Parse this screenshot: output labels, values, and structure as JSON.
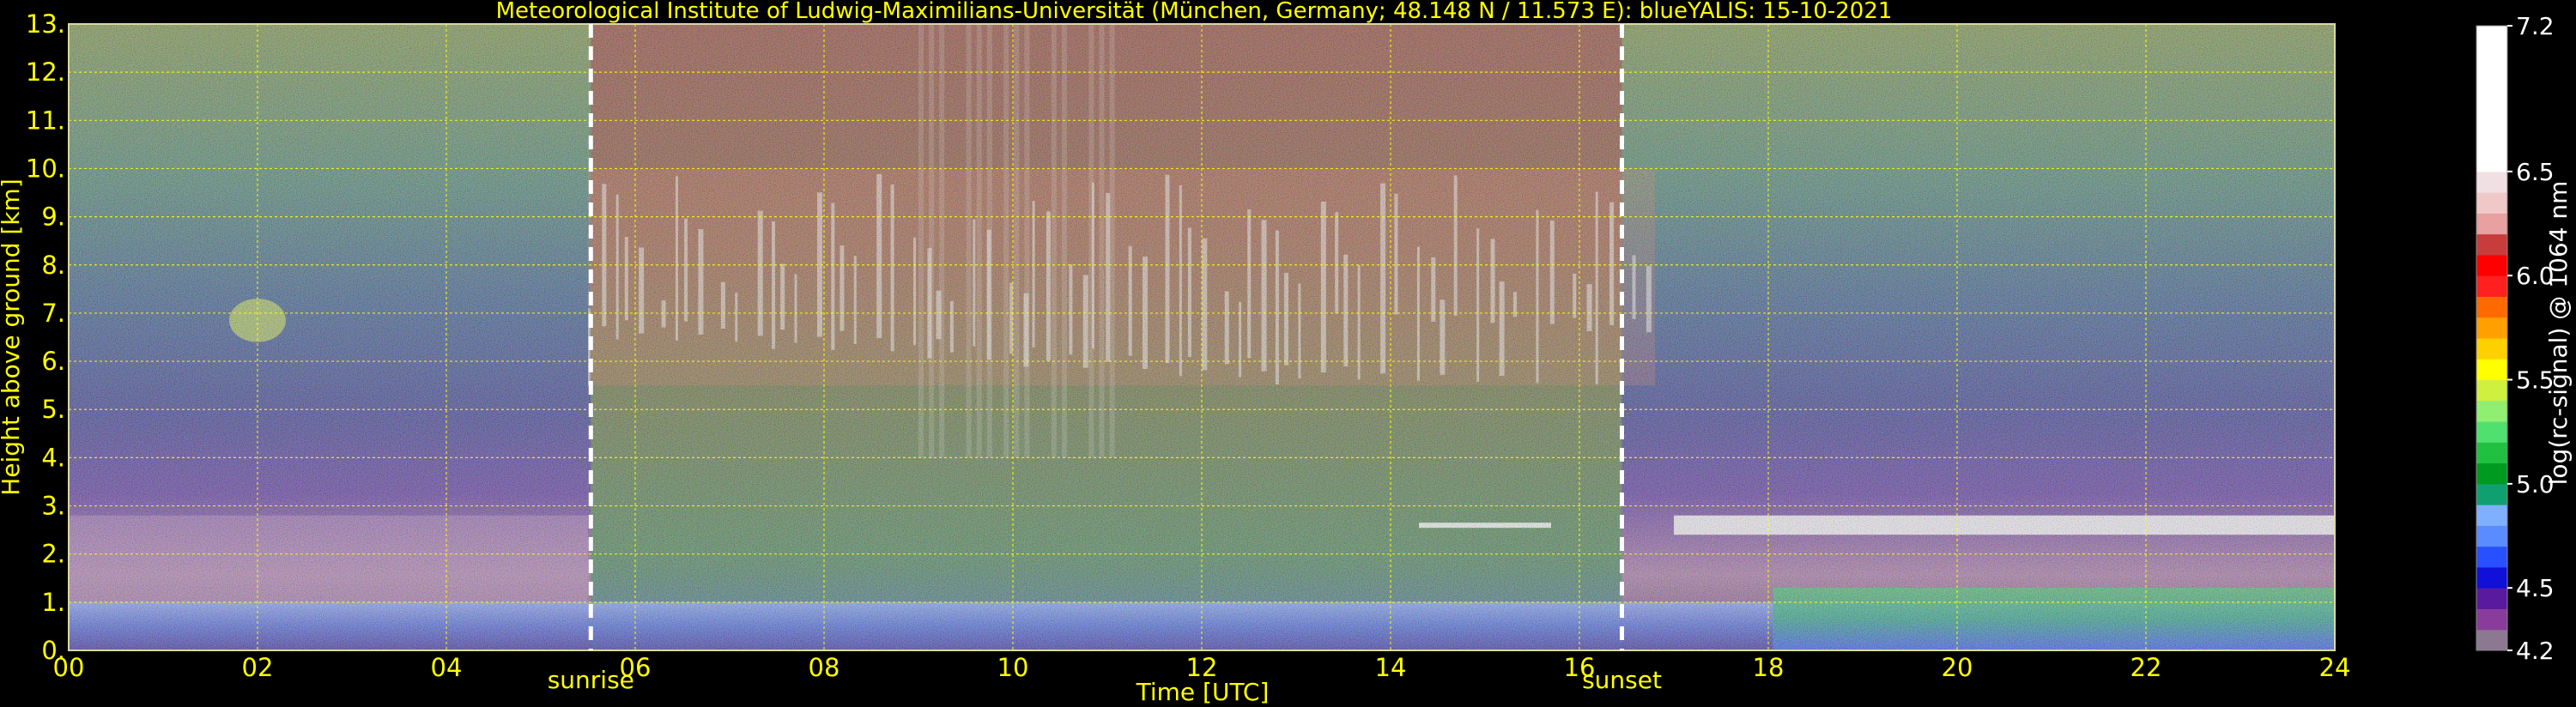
{
  "chart_data": {
    "type": "heatmap",
    "title": "Meteorological Institute of Ludwig-Maximilians-Universität (München, Germany; 48.148 N / 11.573 E):     blueYALIS: 15-10-2021",
    "xlabel": "Time [UTC]",
    "ylabel": "Height above ground [km]",
    "xlim": [
      0,
      24
    ],
    "ylim": [
      0,
      13
    ],
    "x_ticks": [
      "00",
      "02",
      "04",
      "06",
      "08",
      "10",
      "12",
      "14",
      "16",
      "18",
      "20",
      "22",
      "24"
    ],
    "y_ticks": [
      "0.",
      "1.",
      "2.",
      "3.",
      "4.",
      "5.",
      "6.",
      "7.",
      "8.",
      "9.",
      "10.",
      "11.",
      "12.",
      "13."
    ],
    "grid": true,
    "annotations": [
      {
        "label": "sunrise",
        "x": 5.53
      },
      {
        "label": "sunset",
        "x": 16.45
      }
    ],
    "colorbar": {
      "label": "log(rc-signal) @ 1064 nm",
      "range": [
        4.2,
        7.2
      ],
      "ticks": [
        "4.2",
        "4.5",
        "5.0",
        "5.5",
        "6.0",
        "6.5",
        "7.2"
      ],
      "tick_values": [
        4.2,
        4.5,
        5.0,
        5.5,
        6.0,
        6.5,
        7.2
      ],
      "segments": [
        {
          "from": 4.2,
          "to": 4.3,
          "color": "#8c7890"
        },
        {
          "from": 4.3,
          "to": 4.4,
          "color": "#8a3c9a"
        },
        {
          "from": 4.4,
          "to": 4.5,
          "color": "#5a1aa0"
        },
        {
          "from": 4.5,
          "to": 4.6,
          "color": "#1010d8"
        },
        {
          "from": 4.6,
          "to": 4.7,
          "color": "#2850ff"
        },
        {
          "from": 4.7,
          "to": 4.8,
          "color": "#5a8cff"
        },
        {
          "from": 4.8,
          "to": 4.9,
          "color": "#7fb0ff"
        },
        {
          "from": 4.9,
          "to": 5.0,
          "color": "#10a070"
        },
        {
          "from": 5.0,
          "to": 5.1,
          "color": "#009a20"
        },
        {
          "from": 5.1,
          "to": 5.2,
          "color": "#20c040"
        },
        {
          "from": 5.2,
          "to": 5.3,
          "color": "#50e070"
        },
        {
          "from": 5.3,
          "to": 5.4,
          "color": "#90ee70"
        },
        {
          "from": 5.4,
          "to": 5.5,
          "color": "#d0f040"
        },
        {
          "from": 5.5,
          "to": 5.6,
          "color": "#ffff00"
        },
        {
          "from": 5.6,
          "to": 5.7,
          "color": "#ffd000"
        },
        {
          "from": 5.7,
          "to": 5.8,
          "color": "#ffa000"
        },
        {
          "from": 5.8,
          "to": 5.9,
          "color": "#ff6a00"
        },
        {
          "from": 5.9,
          "to": 6.0,
          "color": "#ff2020"
        },
        {
          "from": 6.0,
          "to": 6.1,
          "color": "#ff0000"
        },
        {
          "from": 6.1,
          "to": 6.2,
          "color": "#c83c3c"
        },
        {
          "from": 6.2,
          "to": 6.3,
          "color": "#e8a0a0"
        },
        {
          "from": 6.3,
          "to": 6.4,
          "color": "#f0c8c8"
        },
        {
          "from": 6.4,
          "to": 6.5,
          "color": "#f0e0e4"
        },
        {
          "from": 6.5,
          "to": 7.2,
          "color": "#ffffff"
        }
      ]
    },
    "features": [
      {
        "name": "boundary layer",
        "x": [
          0,
          24
        ],
        "y": [
          0,
          1.0
        ]
      },
      {
        "name": "residual layer",
        "x": [
          0,
          5.5
        ],
        "y": [
          1.0,
          2.8
        ]
      },
      {
        "name": "cirrus",
        "x": [
          5.5,
          16.8
        ],
        "y": [
          5.5,
          10.0
        ]
      },
      {
        "name": "cloud layer",
        "x": [
          16.7,
          24
        ],
        "y": [
          2.2,
          3.0
        ]
      },
      {
        "name": "aerosol patch",
        "x": [
          1.7,
          2.3
        ],
        "y": [
          6.4,
          7.3
        ]
      }
    ],
    "colors": {
      "text": "#ffff00",
      "grid": "#ffff00",
      "marker": "#ffffff",
      "background": "#000000"
    }
  }
}
